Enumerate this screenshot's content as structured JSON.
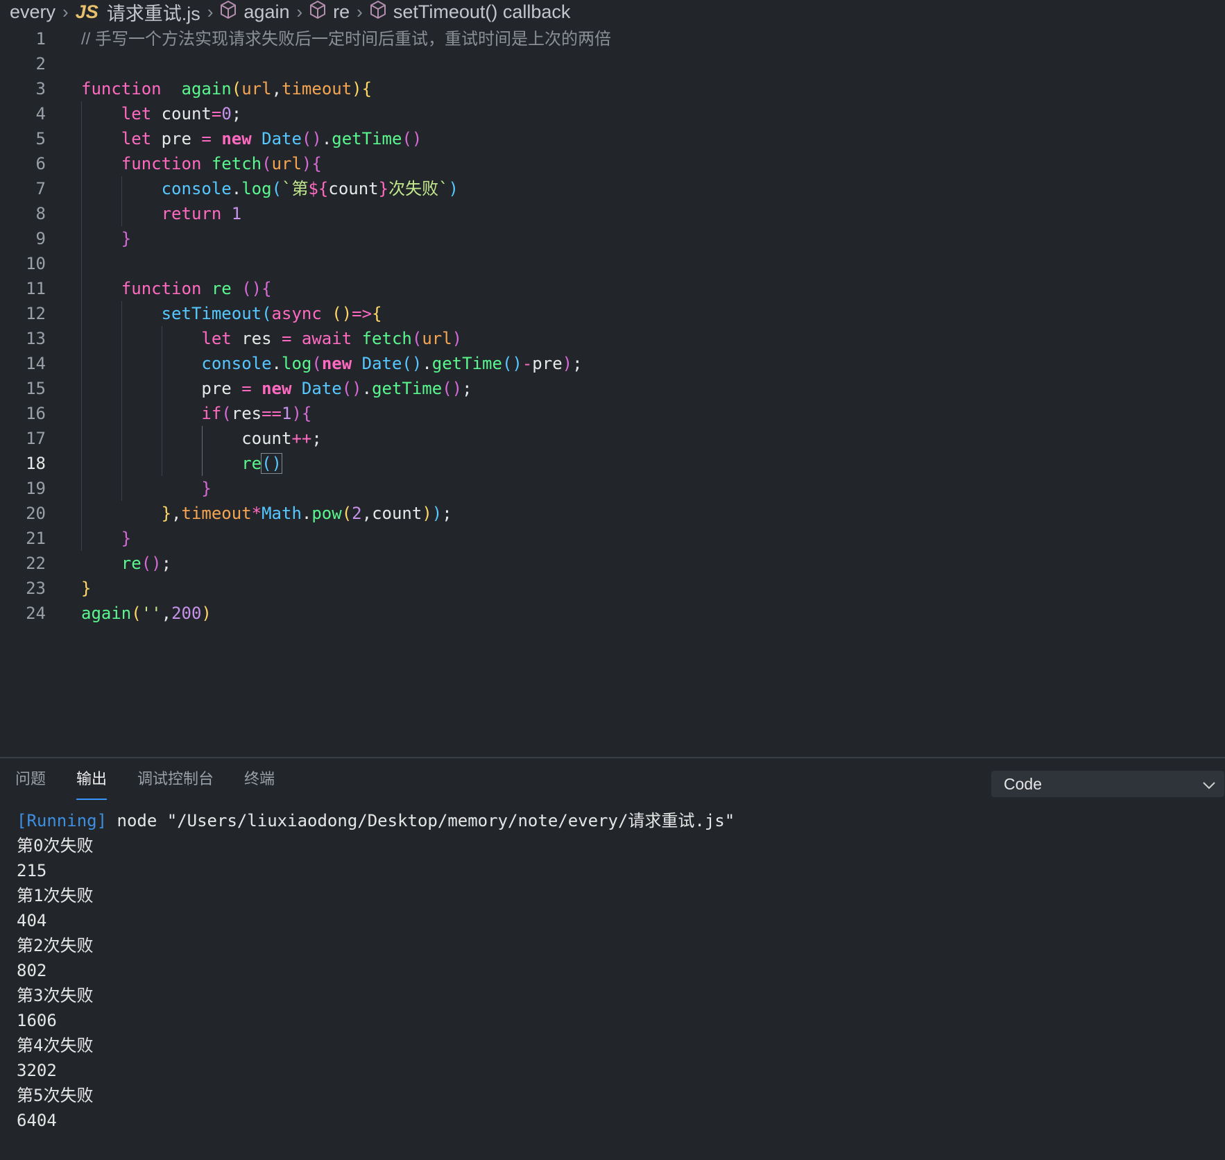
{
  "breadcrumb": {
    "folder": "every",
    "file_badge": "JS",
    "file": "请求重试.js",
    "symbols": [
      "again",
      "re",
      "setTimeout() callback"
    ]
  },
  "editor": {
    "active_line": 18,
    "line_numbers": [
      "1",
      "2",
      "3",
      "4",
      "5",
      "6",
      "7",
      "8",
      "9",
      "10",
      "11",
      "12",
      "13",
      "14",
      "15",
      "16",
      "17",
      "18",
      "19",
      "20",
      "21",
      "22",
      "23",
      "24"
    ],
    "lines": [
      [
        [
          "cm",
          "// 手写一个方法实现请求失败后一定时间后重试，重试时间是上次的两倍"
        ]
      ],
      [],
      [
        [
          "kw",
          "function"
        ],
        [
          "",
          "  "
        ],
        [
          "fn",
          "again"
        ],
        [
          "b1",
          "("
        ],
        [
          "pa",
          "url"
        ],
        [
          "",
          ","
        ],
        [
          "pa",
          "timeout"
        ],
        [
          "b1",
          ")"
        ],
        [
          "b1",
          "{"
        ]
      ],
      [
        [
          "",
          "    "
        ],
        [
          "kw",
          "let"
        ],
        [
          "",
          " count"
        ],
        [
          "op",
          "="
        ],
        [
          "num",
          "0"
        ],
        [
          "",
          ";"
        ]
      ],
      [
        [
          "",
          "    "
        ],
        [
          "kw",
          "let"
        ],
        [
          "",
          " pre "
        ],
        [
          "op",
          "="
        ],
        [
          "",
          " "
        ],
        [
          "kw bold",
          "new"
        ],
        [
          "",
          " "
        ],
        [
          "cls",
          "Date"
        ],
        [
          "b2",
          "()"
        ],
        [
          "",
          "."
        ],
        [
          "fn",
          "getTime"
        ],
        [
          "b2",
          "()"
        ]
      ],
      [
        [
          "",
          "    "
        ],
        [
          "kw",
          "function"
        ],
        [
          "",
          " "
        ],
        [
          "fn",
          "fetch"
        ],
        [
          "b2",
          "("
        ],
        [
          "pa",
          "url"
        ],
        [
          "b2",
          ")"
        ],
        [
          "b2",
          "{"
        ]
      ],
      [
        [
          "",
          "        "
        ],
        [
          "cls",
          "console"
        ],
        [
          "",
          "."
        ],
        [
          "fn",
          "log"
        ],
        [
          "b3",
          "("
        ],
        [
          "str",
          "`第"
        ],
        [
          "kw",
          "${"
        ],
        [
          "",
          "count"
        ],
        [
          "kw",
          "}"
        ],
        [
          "str",
          "次失败`"
        ],
        [
          "b3",
          ")"
        ]
      ],
      [
        [
          "",
          "        "
        ],
        [
          "kw",
          "return"
        ],
        [
          "",
          " "
        ],
        [
          "num",
          "1"
        ]
      ],
      [
        [
          "",
          "    "
        ],
        [
          "b2",
          "}"
        ]
      ],
      [],
      [
        [
          "",
          "    "
        ],
        [
          "kw",
          "function"
        ],
        [
          "",
          " "
        ],
        [
          "fn",
          "re"
        ],
        [
          "",
          " "
        ],
        [
          "b2",
          "()"
        ],
        [
          "b2",
          "{"
        ]
      ],
      [
        [
          "",
          "        "
        ],
        [
          "cls",
          "setTimeout"
        ],
        [
          "b3",
          "("
        ],
        [
          "kw",
          "async"
        ],
        [
          "",
          " "
        ],
        [
          "b1",
          "()"
        ],
        [
          "op",
          "=>"
        ],
        [
          "b1",
          "{"
        ]
      ],
      [
        [
          "",
          "            "
        ],
        [
          "kw",
          "let"
        ],
        [
          "",
          " res "
        ],
        [
          "op",
          "="
        ],
        [
          "",
          " "
        ],
        [
          "kw",
          "await"
        ],
        [
          "",
          " "
        ],
        [
          "fn",
          "fetch"
        ],
        [
          "b2",
          "("
        ],
        [
          "pa",
          "url"
        ],
        [
          "b2",
          ")"
        ]
      ],
      [
        [
          "",
          "            "
        ],
        [
          "cls",
          "console"
        ],
        [
          "",
          "."
        ],
        [
          "fn",
          "log"
        ],
        [
          "b2",
          "("
        ],
        [
          "kw bold",
          "new"
        ],
        [
          "",
          " "
        ],
        [
          "cls",
          "Date"
        ],
        [
          "b3",
          "()"
        ],
        [
          "",
          "."
        ],
        [
          "fn",
          "getTime"
        ],
        [
          "b3",
          "()"
        ],
        [
          "op",
          "-"
        ],
        [
          "",
          "pre"
        ],
        [
          "b2",
          ")"
        ],
        [
          "",
          ";"
        ]
      ],
      [
        [
          "",
          "            pre "
        ],
        [
          "op",
          "="
        ],
        [
          "",
          " "
        ],
        [
          "kw bold",
          "new"
        ],
        [
          "",
          " "
        ],
        [
          "cls",
          "Date"
        ],
        [
          "b2",
          "()"
        ],
        [
          "",
          "."
        ],
        [
          "fn",
          "getTime"
        ],
        [
          "b2",
          "()"
        ],
        [
          "",
          ";"
        ]
      ],
      [
        [
          "",
          "            "
        ],
        [
          "kw",
          "if"
        ],
        [
          "b2",
          "("
        ],
        [
          "",
          "res"
        ],
        [
          "op",
          "=="
        ],
        [
          "num",
          "1"
        ],
        [
          "b2",
          ")"
        ],
        [
          "b2",
          "{"
        ]
      ],
      [
        [
          "",
          "                count"
        ],
        [
          "op",
          "++"
        ],
        [
          "",
          ";"
        ]
      ],
      [
        [
          "",
          "                "
        ],
        [
          "fn",
          "re"
        ],
        [
          "b3 bracket-box",
          "()"
        ]
      ],
      [
        [
          "",
          "            "
        ],
        [
          "b2",
          "}"
        ]
      ],
      [
        [
          "",
          "        "
        ],
        [
          "b1",
          "}"
        ],
        [
          "",
          ","
        ],
        [
          "pa",
          "timeout"
        ],
        [
          "op",
          "*"
        ],
        [
          "cls",
          "Math"
        ],
        [
          "",
          "."
        ],
        [
          "fn",
          "pow"
        ],
        [
          "b1",
          "("
        ],
        [
          "num",
          "2"
        ],
        [
          "",
          ",count"
        ],
        [
          "b1",
          ")"
        ],
        [
          "b3",
          ")"
        ],
        [
          "",
          ";"
        ]
      ],
      [
        [
          "",
          "    "
        ],
        [
          "b2",
          "}"
        ]
      ],
      [
        [
          "",
          "    "
        ],
        [
          "fn",
          "re"
        ],
        [
          "b2",
          "()"
        ],
        [
          "",
          ";"
        ]
      ],
      [
        [
          "b1",
          "}"
        ]
      ],
      [
        [
          "fn",
          "again"
        ],
        [
          "b1",
          "("
        ],
        [
          "str",
          "''"
        ],
        [
          "",
          ","
        ],
        [
          "num",
          "200"
        ],
        [
          "b1",
          ")"
        ]
      ]
    ]
  },
  "panel": {
    "tabs": [
      "问题",
      "输出",
      "调试控制台",
      "终端"
    ],
    "active_tab": "输出",
    "channel": "Code",
    "running_tag": "[Running]",
    "command": " node \"/Users/liuxiaodong/Desktop/memory/note/every/请求重试.js\"",
    "output": [
      "第0次失败",
      "215",
      "第1次失败",
      "404",
      "第2次失败",
      "802",
      "第3次失败",
      "1606",
      "第4次失败",
      "3202",
      "第5次失败",
      "6404"
    ]
  }
}
